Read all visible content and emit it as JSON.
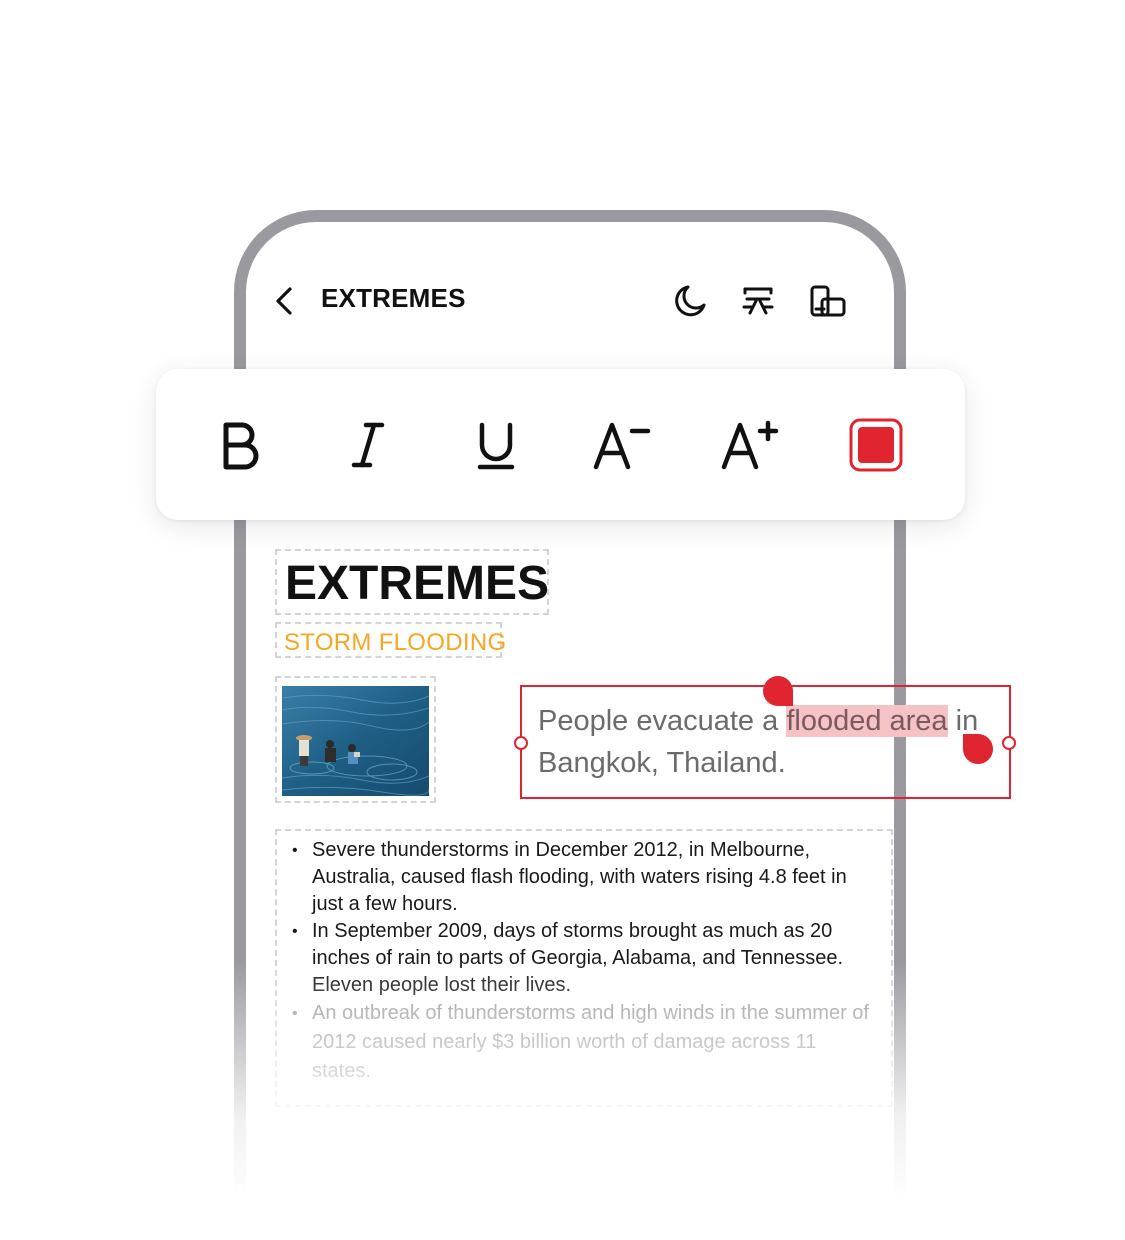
{
  "header": {
    "title": "EXTREMES",
    "icons": [
      "back-chevron-icon",
      "moon-icon",
      "text-layout-icon",
      "device-rotate-icon"
    ]
  },
  "toolbar": {
    "buttons": [
      {
        "name": "bold",
        "glyph": "B"
      },
      {
        "name": "italic",
        "glyph": "I"
      },
      {
        "name": "underline",
        "glyph": "U"
      },
      {
        "name": "decrease-font",
        "glyph": "A−"
      },
      {
        "name": "increase-font",
        "glyph": "A+"
      },
      {
        "name": "text-color",
        "color": "#e02530"
      }
    ]
  },
  "document": {
    "title": "EXTREMES",
    "subtitle": "STORM FLOODING",
    "caption": {
      "before": "People evacuate a ",
      "selected": "flooded area",
      "after": " in Bangkok, Thailand."
    },
    "bullets": [
      "Severe thunderstorms in December 2012, in Melbourne, Australia, caused flash flooding, with waters rising 4.8 feet in just a few hours.",
      "In September 2009, days of storms brought as much as 20 inches of rain to parts of Georgia, Alabama, and Tennessee. Eleven people lost their lives.",
      "An outbreak of thunderstorms and high winds in the summer of 2012 caused nearly $3 billion worth of damage across 11 states."
    ]
  },
  "colors": {
    "accent": "#e02530",
    "subtitle": "#f5a623",
    "frame": "#9a99a0",
    "highlight": "#f5c2c5"
  }
}
